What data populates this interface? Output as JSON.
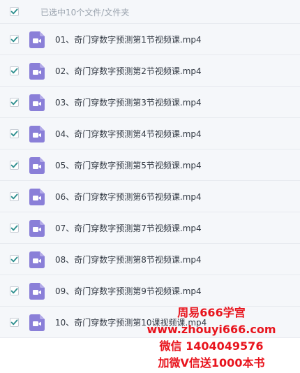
{
  "header": {
    "selected_label": "已选中10个文件/文件夹"
  },
  "files": [
    {
      "name": "01、奇门穿数字预测第1节视频课.mp4"
    },
    {
      "name": "02、奇门穿数字预测第2节视频课.mp4"
    },
    {
      "name": "03、奇门穿数字预测第3节视频课.mp4"
    },
    {
      "name": "04、奇门穿数字预测第4节视频课.mp4"
    },
    {
      "name": "05、奇门穿数字预测第5节视频课.mp4"
    },
    {
      "name": "06、奇门穿数字预测第6节视频课.mp4"
    },
    {
      "name": "07、奇门穿数字预测第7节视频课.mp4"
    },
    {
      "name": "08、奇门穿数字预测第8节视频课.mp4"
    },
    {
      "name": "09、奇门穿数字预测第9节视频课.mp4"
    },
    {
      "name": "10、奇门穿数字预测第10课视频课.mp4"
    }
  ],
  "icons": {
    "checkbox": "check-icon",
    "file": "video-file-icon"
  },
  "colors": {
    "check": "#2e8f8f",
    "file_icon": "#8a7fd8",
    "watermark": "#e8141d"
  },
  "watermark": {
    "line1": "周易666学宫",
    "line2": "www.zhouyi666.com",
    "line3": "微信 1404049576",
    "line4": "加微V信送1000本书"
  }
}
